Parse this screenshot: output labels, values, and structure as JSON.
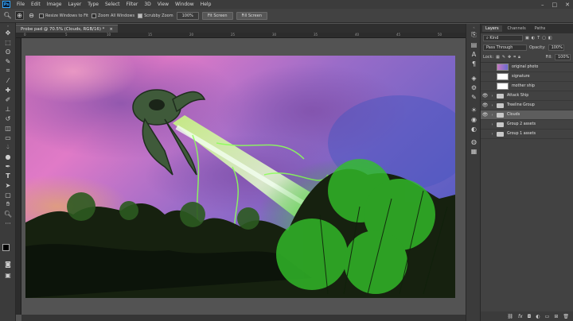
{
  "app": {
    "logo": "Ps"
  },
  "menu": [
    "File",
    "Edit",
    "Image",
    "Layer",
    "Type",
    "Select",
    "Filter",
    "3D",
    "View",
    "Window",
    "Help"
  ],
  "window_controls": {
    "minimize": "–",
    "maximize": "□",
    "close": "✕"
  },
  "options_bar": {
    "resize_windows": "Resize Windows to Fit",
    "zoom_all": "Zoom All Windows",
    "scrubby_zoom": "Scrubby Zoom",
    "zoom_value": "100%",
    "fit_screen": "Fit Screen",
    "fill_screen": "Fill Screen"
  },
  "document": {
    "tab_title": "Probe pad @ 70.5% (Clouds, RGB/16) *",
    "close": "×"
  },
  "ruler": {
    "marks": [
      "0",
      "5",
      "10",
      "15",
      "20",
      "25",
      "30",
      "35",
      "40",
      "45",
      "50"
    ]
  },
  "layers_panel": {
    "tabs": [
      "Layers",
      "Channels",
      "Paths"
    ],
    "filter_kind": "Kind",
    "blend_mode": "Pass Through",
    "opacity_label": "Opacity:",
    "opacity_value": "100%",
    "lock_label": "Lock:",
    "fill_label": "Fill:",
    "fill_value": "100%",
    "layers": [
      {
        "name": "original photo",
        "type": "image",
        "visible": false,
        "selected": false
      },
      {
        "name": "signature",
        "type": "image",
        "visible": false,
        "selected": false
      },
      {
        "name": "mother ship",
        "type": "image",
        "visible": false,
        "selected": false
      },
      {
        "name": "Attack Ship",
        "type": "group",
        "visible": true,
        "selected": false
      },
      {
        "name": "Treeline Group",
        "type": "group",
        "visible": true,
        "selected": false
      },
      {
        "name": "Clouds",
        "type": "group",
        "visible": true,
        "selected": true
      },
      {
        "name": "Group 2 assets",
        "type": "group",
        "visible": false,
        "selected": false
      },
      {
        "name": "Group 1 assets",
        "type": "group",
        "visible": false,
        "selected": false
      }
    ]
  }
}
